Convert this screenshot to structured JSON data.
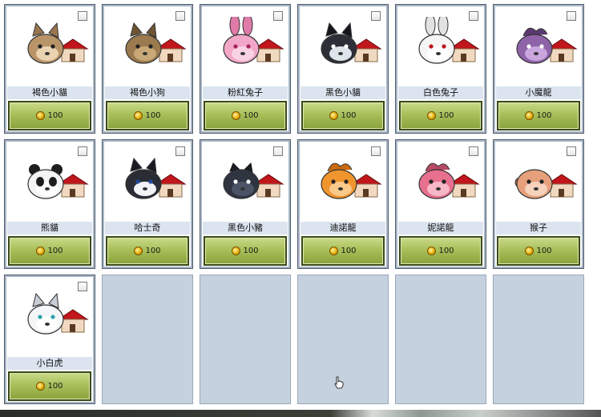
{
  "shop": {
    "items": [
      {
        "name": "褐色小貓",
        "price": "100",
        "pet": "cat-brown"
      },
      {
        "name": "褐色小狗",
        "price": "100",
        "pet": "dog-brown"
      },
      {
        "name": "粉紅兔子",
        "price": "100",
        "pet": "rabbit-pink"
      },
      {
        "name": "黑色小貓",
        "price": "100",
        "pet": "cat-black"
      },
      {
        "name": "白色兔子",
        "price": "100",
        "pet": "rabbit-white"
      },
      {
        "name": "小魔龍",
        "price": "100",
        "pet": "dragon-purple"
      },
      {
        "name": "熊貓",
        "price": "100",
        "pet": "panda"
      },
      {
        "name": "哈士奇",
        "price": "100",
        "pet": "husky"
      },
      {
        "name": "黑色小豬",
        "price": "100",
        "pet": "pig-black"
      },
      {
        "name": "迪諾龍",
        "price": "100",
        "pet": "dino-orange"
      },
      {
        "name": "妮諾龍",
        "price": "100",
        "pet": "dino-pink"
      },
      {
        "name": "猴子",
        "price": "100",
        "pet": "monkey"
      },
      {
        "name": "小白虎",
        "price": "100",
        "pet": "tiger-white"
      }
    ],
    "empty_slots": 5,
    "colors": {
      "button": "#a9c05a",
      "name_bar": "#dbe4ef",
      "empty": "#c5d1de",
      "coin": "#e0a800",
      "house_roof": "#c0161c"
    }
  }
}
